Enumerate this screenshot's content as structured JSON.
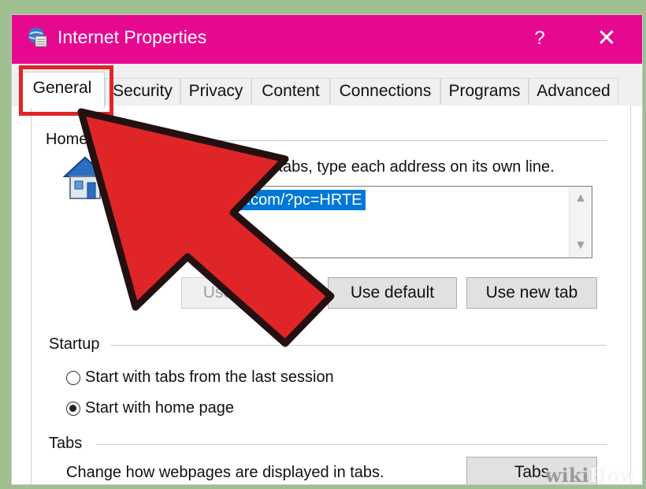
{
  "window": {
    "title": "Internet Properties",
    "help": "?",
    "close": "✕",
    "accent_color": "#e6098f"
  },
  "tabs": [
    {
      "label": "General",
      "active": true
    },
    {
      "label": "Security",
      "active": false
    },
    {
      "label": "Privacy",
      "active": false
    },
    {
      "label": "Content",
      "active": false
    },
    {
      "label": "Connections",
      "active": false
    },
    {
      "label": "Programs",
      "active": false
    },
    {
      "label": "Advanced",
      "active": false
    }
  ],
  "home": {
    "group_label": "Home page",
    "instructions": "To create home page tabs, type each address on its own line.",
    "url_value": "http://www.msn.com/?pc=HRTE",
    "use_current_label": "Use current",
    "use_default_label": "Use default",
    "use_new_tab_label": "Use new tab"
  },
  "startup": {
    "group_label": "Startup",
    "options": [
      {
        "label": "Start with tabs from the last session",
        "checked": false
      },
      {
        "label": "Start with home page",
        "checked": true
      }
    ]
  },
  "tabs_section": {
    "group_label": "Tabs",
    "description": "Change how webpages are displayed in tabs.",
    "button_label": "Tabs"
  },
  "overlay": {
    "highlight_color": "#e02528",
    "arrow_color": "#e02528",
    "watermark_wiki": "wiki",
    "watermark_how": "How"
  }
}
